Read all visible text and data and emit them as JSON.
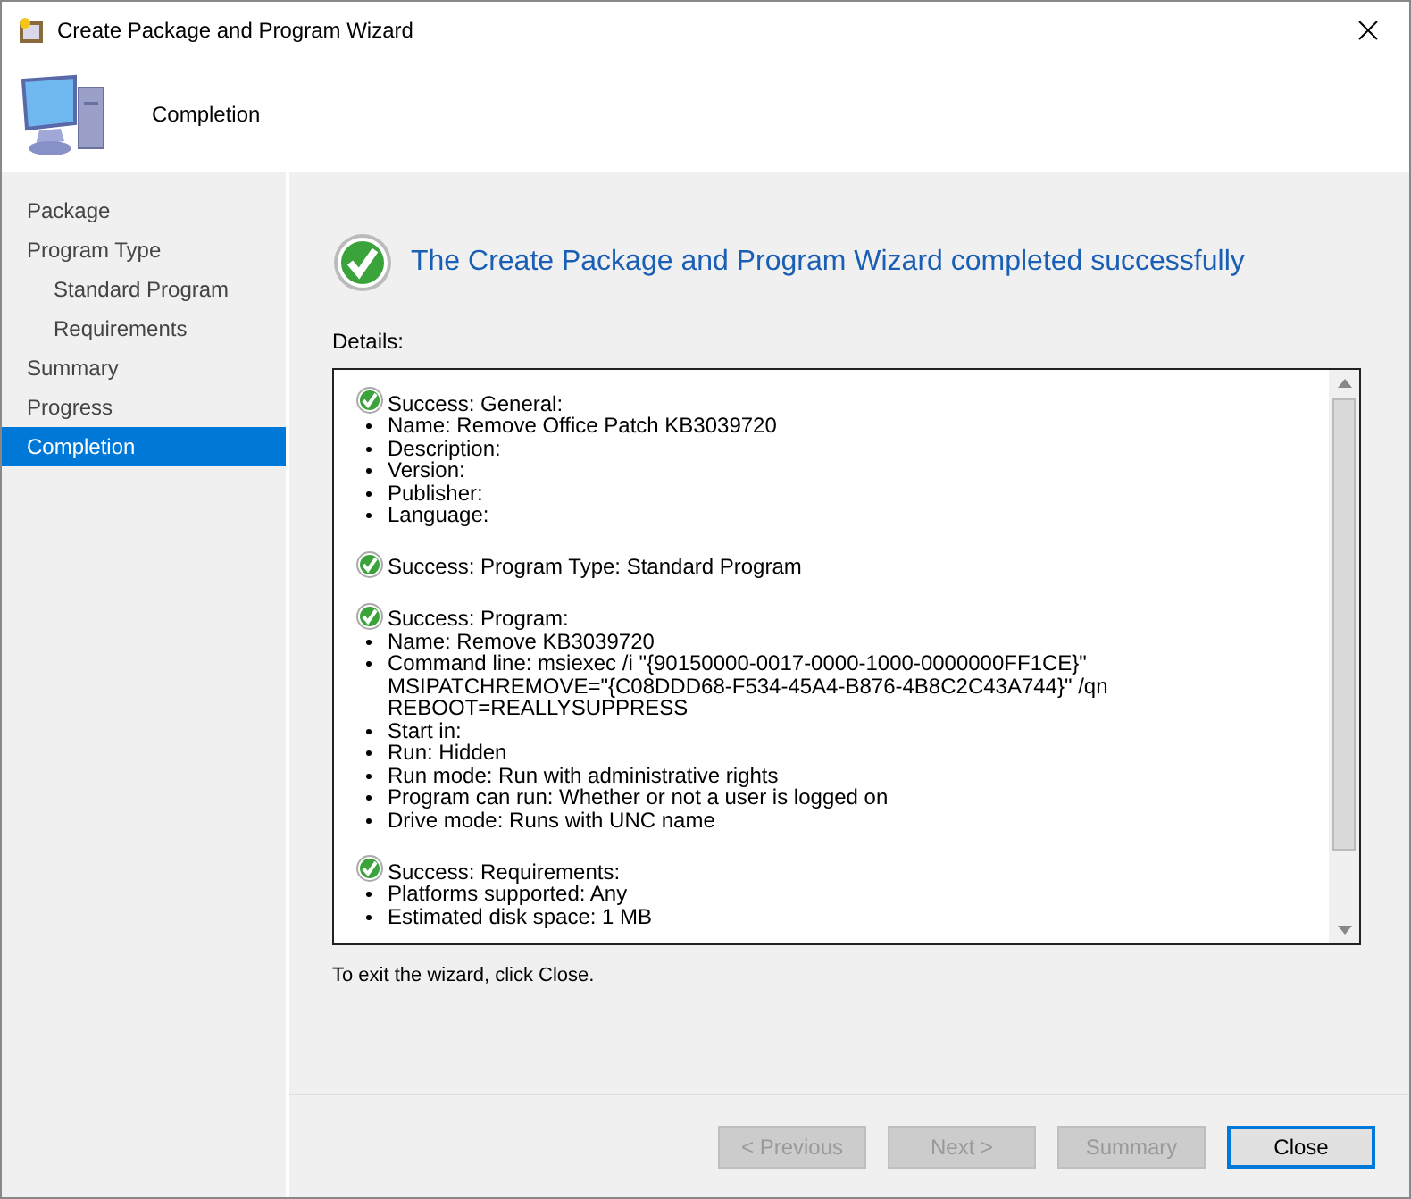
{
  "window": {
    "title": "Create Package and Program Wizard"
  },
  "header": {
    "title": "Completion"
  },
  "nav": [
    {
      "label": "Package",
      "selected": false
    },
    {
      "label": "Program Type",
      "selected": false,
      "children": [
        {
          "label": "Standard Program",
          "selected": false
        },
        {
          "label": "Requirements",
          "selected": false
        }
      ]
    },
    {
      "label": "Summary",
      "selected": false
    },
    {
      "label": "Progress",
      "selected": false
    },
    {
      "label": "Completion",
      "selected": true
    }
  ],
  "result": {
    "heading": "The Create Package and Program Wizard completed successfully"
  },
  "details": {
    "label": "Details:",
    "sections": [
      {
        "title": "Success: General:",
        "items": [
          "Name: Remove Office Patch KB3039720",
          "Description:",
          "Version:",
          "Publisher:",
          "Language:"
        ]
      },
      {
        "title": "Success: Program Type: Standard Program"
      },
      {
        "title": "Success: Program:",
        "items": [
          "Name: Remove KB3039720",
          "Command line: msiexec /i \"{90150000-0017-0000-1000-0000000FF1CE}\"\nMSIPATCHREMOVE=\"{C08DDD68-F534-45A4-B876-4B8C2C43A744}\" /qn\nREBOOT=REALLYSUPPRESS",
          "Start in:",
          "Run: Hidden",
          "Run mode: Run with administrative rights",
          "Program can run: Whether or not a user is logged on",
          "Drive mode: Runs with UNC name"
        ]
      },
      {
        "title": "Success: Requirements:",
        "items": [
          "Platforms supported: Any",
          "Estimated disk space: 1 MB"
        ]
      }
    ]
  },
  "footer_text": "To exit the wizard, click Close.",
  "buttons": [
    {
      "label": "< Previous",
      "disabled": true,
      "default": false
    },
    {
      "label": "Next >",
      "disabled": true,
      "default": false
    },
    {
      "label": "Summary",
      "disabled": true,
      "default": false
    },
    {
      "label": "Close",
      "disabled": false,
      "default": true
    }
  ]
}
